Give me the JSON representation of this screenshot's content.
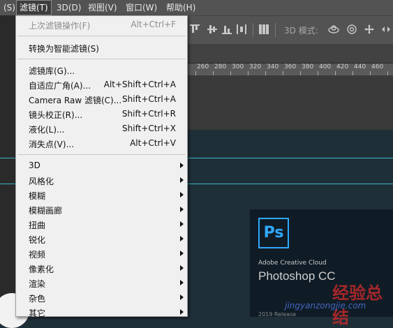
{
  "menubar": {
    "items": [
      {
        "label": "(S)"
      },
      {
        "label": "滤镜(T)"
      },
      {
        "label": "3D(D)"
      },
      {
        "label": "视图(V)"
      },
      {
        "label": "窗口(W)"
      },
      {
        "label": "帮助(H)"
      }
    ]
  },
  "options_bar": {
    "mode_label": "3D 模式:"
  },
  "ruler": {
    "ticks": [
      "260",
      "280",
      "300",
      "320",
      "340",
      "360",
      "380",
      "400",
      "420",
      "440",
      "460"
    ]
  },
  "filter_menu": {
    "last_filter": {
      "label": "上次滤镜操作(F)",
      "shortcut": "Alt+Ctrl+F"
    },
    "convert_smart": {
      "label": "转换为智能滤镜(S)"
    },
    "group1": [
      {
        "label": "滤镜库(G)...",
        "shortcut": ""
      },
      {
        "label": "自适应广角(A)...",
        "shortcut": "Alt+Shift+Ctrl+A"
      },
      {
        "label": "Camera Raw 滤镜(C)...",
        "shortcut": "Shift+Ctrl+A"
      },
      {
        "label": "镜头校正(R)...",
        "shortcut": "Shift+Ctrl+R"
      },
      {
        "label": "液化(L)...",
        "shortcut": "Shift+Ctrl+X"
      },
      {
        "label": "消失点(V)...",
        "shortcut": "Alt+Ctrl+V"
      }
    ],
    "submenus": [
      {
        "label": "3D"
      },
      {
        "label": "风格化"
      },
      {
        "label": "模糊"
      },
      {
        "label": "模糊画廊"
      },
      {
        "label": "扭曲"
      },
      {
        "label": "锐化"
      },
      {
        "label": "视频"
      },
      {
        "label": "像素化"
      },
      {
        "label": "渲染"
      },
      {
        "label": "杂色"
      },
      {
        "label": "其它"
      }
    ]
  },
  "splash": {
    "logo": "Ps",
    "company": "Adobe Creative Cloud",
    "product": "Photoshop CC",
    "release": "2019 Release"
  },
  "watermark": {
    "text": "经验总结",
    "url": "jingyanzongjie.com"
  },
  "colors": {
    "menu_bg": "#f0f0f0",
    "guide": "#3ab7c4",
    "ps_blue": "#31a8ff",
    "canvas_bg": "#1f2f38"
  }
}
